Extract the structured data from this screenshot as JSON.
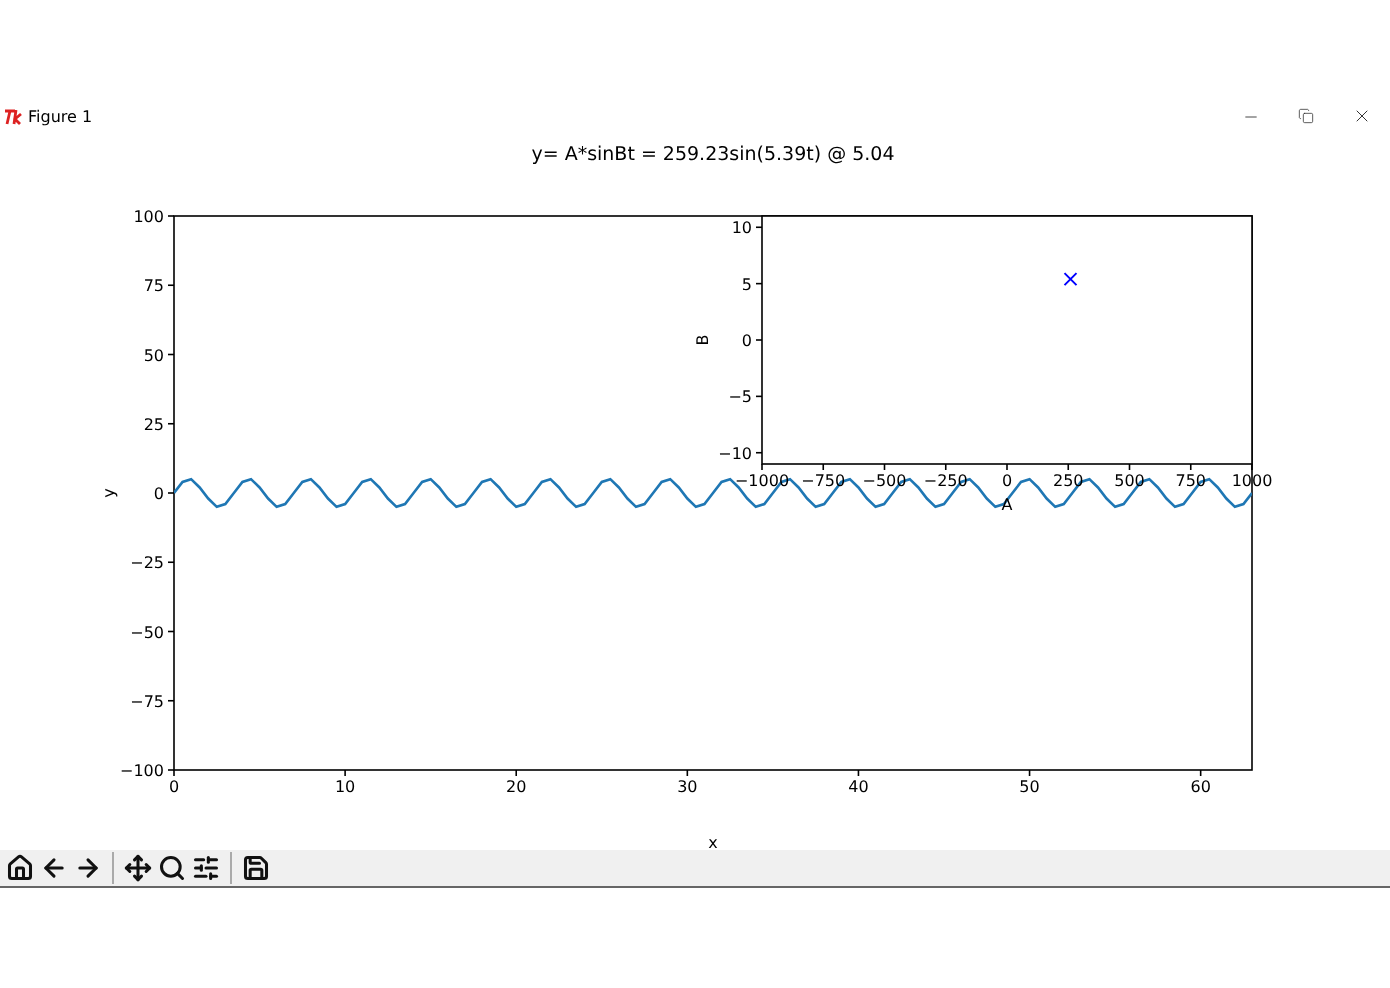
{
  "window": {
    "title": "Figure 1"
  },
  "figure": {
    "main_axes": {
      "chart_data": {
        "type": "line",
        "title": "y= A*sinBt = 259.23sin(5.39t) @ 5.04",
        "xlabel": "x",
        "ylabel": "y",
        "xlim": [
          0,
          63
        ],
        "ylim": [
          -100,
          100
        ],
        "xticks": [
          0,
          10,
          20,
          30,
          40,
          50,
          60
        ],
        "yticks": [
          {
            "value": -100,
            "label": "−100"
          },
          {
            "value": -75,
            "label": "−75"
          },
          {
            "value": -50,
            "label": "−50"
          },
          {
            "value": -25,
            "label": "−25"
          },
          0,
          25,
          50,
          75,
          100
        ],
        "x": [
          0,
          0.5,
          1,
          1.5,
          2,
          2.5,
          3,
          3.5,
          4,
          4.5,
          5,
          5.5,
          6,
          6.5,
          7,
          7.5,
          8,
          8.5,
          9,
          9.5,
          10,
          10.5,
          11,
          11.5,
          12,
          12.5,
          13,
          13.5,
          14,
          14.5,
          15,
          15.5,
          16,
          16.5,
          17,
          17.5,
          18,
          18.5,
          19,
          19.5,
          20,
          20.5,
          21,
          21.5,
          22,
          22.5,
          23,
          23.5,
          24,
          24.5,
          25,
          25.5,
          26,
          26.5,
          27,
          27.5,
          28,
          28.5,
          29,
          29.5,
          30,
          30.5,
          31,
          31.5,
          32,
          32.5,
          33,
          33.5,
          34,
          34.5,
          35,
          35.5,
          36,
          36.5,
          37,
          37.5,
          38,
          38.5,
          39,
          39.5,
          40,
          40.5,
          41,
          41.5,
          42,
          42.5,
          43,
          43.5,
          44,
          44.5,
          45,
          45.5,
          46,
          46.5,
          47,
          47.5,
          48,
          48.5,
          49,
          49.5,
          50,
          50.5,
          51,
          51.5,
          52,
          52.5,
          53,
          53.5,
          54,
          54.5,
          55,
          55.5,
          56,
          56.5,
          57,
          57.5,
          58,
          58.5,
          59,
          59.5,
          60,
          60.5,
          61,
          61.5,
          62,
          62.5,
          63
        ],
        "series": [
          {
            "color": "#1f77b4",
            "values": [
              0,
              4,
              5,
              2,
              -2,
              -5,
              -4,
              0,
              4,
              5,
              2,
              -2,
              -5,
              -4,
              0,
              4,
              5,
              2,
              -2,
              -5,
              -4,
              0,
              4,
              5,
              2,
              -2,
              -5,
              -4,
              0,
              4,
              5,
              2,
              -2,
              -5,
              -4,
              0,
              4,
              5,
              2,
              -2,
              -5,
              -4,
              0,
              4,
              5,
              2,
              -2,
              -5,
              -4,
              0,
              4,
              5,
              2,
              -2,
              -5,
              -4,
              0,
              4,
              5,
              2,
              -2,
              -5,
              -4,
              0,
              4,
              5,
              2,
              -2,
              -5,
              -4,
              0,
              4,
              5,
              2,
              -2,
              -5,
              -4,
              0,
              4,
              5,
              2,
              -2,
              -5,
              -4,
              0,
              4,
              5,
              2,
              -2,
              -5,
              -4,
              0,
              4,
              5,
              2,
              -2,
              -5,
              -4,
              0,
              4,
              5,
              2,
              -2,
              -5,
              -4,
              0,
              4,
              5,
              2,
              -2,
              -5,
              -4,
              0,
              4,
              5,
              2,
              -2,
              -5,
              -4,
              0,
              4,
              5,
              2,
              -2,
              -5,
              -4,
              0
            ]
          }
        ]
      }
    },
    "inset_axes": {
      "chart_data": {
        "type": "scatter",
        "xlabel": "A",
        "ylabel": "B",
        "xlim": [
          -1000,
          1000
        ],
        "ylim": [
          -11,
          11
        ],
        "xticks": [
          {
            "value": -1000,
            "label": "−1000"
          },
          {
            "value": -750,
            "label": "−750"
          },
          {
            "value": -500,
            "label": "−500"
          },
          {
            "value": -250,
            "label": "−250"
          },
          0,
          250,
          500,
          750,
          1000
        ],
        "yticks": [
          {
            "value": -10,
            "label": "−10"
          },
          {
            "value": -5,
            "label": "−5"
          },
          0,
          5,
          10
        ],
        "x": [
          259.23
        ],
        "series": [
          {
            "color": "#0000ff",
            "values": [
              5.4
            ]
          }
        ]
      }
    }
  },
  "toolbar": {
    "buttons": [
      {
        "kind": "home"
      },
      {
        "kind": "back"
      },
      {
        "kind": "forward"
      },
      {
        "kind": "separator"
      },
      {
        "kind": "pan"
      },
      {
        "kind": "zoom"
      },
      {
        "kind": "configure"
      },
      {
        "kind": "separator"
      },
      {
        "kind": "save"
      }
    ]
  }
}
